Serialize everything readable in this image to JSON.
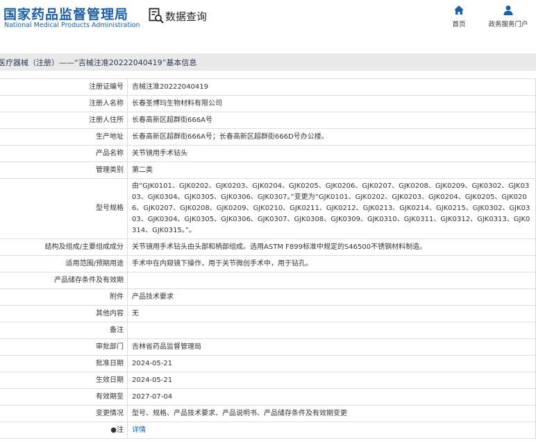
{
  "header": {
    "logo_cn": "国家药品监督管理局",
    "logo_en": "National Medical Products Administration",
    "query_label": "数据查询",
    "query_icon": "document-search-icon",
    "nav": [
      {
        "label": "首页",
        "icon": "home-icon"
      },
      {
        "label": "政务服务门户",
        "icon": "user-icon"
      }
    ]
  },
  "breadcrumb": "医疗器械（注册）——“吉械注准20222040419”基本信息",
  "fields": [
    {
      "label": "注册证编号",
      "value": "吉械注准20222040419"
    },
    {
      "label": "注册人名称",
      "value": "长春圣博玛生物材料有限公司"
    },
    {
      "label": "注册人住所",
      "value": "长春高新区超群街666A号"
    },
    {
      "label": "生产地址",
      "value": "长春高新区超群街666A号；长春高新区超群街666D号办公楼。"
    },
    {
      "label": "产品名称",
      "value": "关节镜用手术钻头"
    },
    {
      "label": "管理类别",
      "value": "第二类"
    },
    {
      "label": "型号规格",
      "value": "由“GJK0101、GJK0202、GJK0203、GJK0204、GJK0205、GJK0206、GJK0207、GJK0208、GJK0209、GJK0302、GJK0303、GJK0304、GJK0305、GJK0306、GJK0307。”变更为“GJK0101、GJK0202、GJK0203、GJK0204、GJK0205、GJK0206、GJK0207、GJK0208、GJK0209、GJK0210、GJK0211、GJK0212、GJK0213、GJK0214、GJK0215、GJK0302、GJK0303、GJK0304、GJK0305、GJK0306、GJK0307、GJK0308、GJK0309、GJK0310、GJK0311、GJK0312、GJK0313、GJK0314、GJK0315。”。"
    },
    {
      "label": "结构及组成/主要组成成分",
      "value": "关节镜用手术钻头由头部和柄部组成。选用ASTM F899标准中规定的S46500不锈钢材料制造。"
    },
    {
      "label": "适用范围/预期用途",
      "value": "手术中在内窥镜下操作，用于关节微创手术中，用于钻孔。"
    },
    {
      "label": "产品储存条件及有效期",
      "value": ""
    },
    {
      "label": "附件",
      "value": "产品技术要求"
    },
    {
      "label": "其他内容",
      "value": "无"
    },
    {
      "label": "备注",
      "value": ""
    },
    {
      "label": "审批部门",
      "value": "吉林省药品监督管理局"
    },
    {
      "label": "批准日期",
      "value": "2024-05-21"
    },
    {
      "label": "生效日期",
      "value": "2024-05-21"
    },
    {
      "label": "有效期至",
      "value": "2027-07-04"
    },
    {
      "label": "变更情况",
      "value": "型号、规格、产品技术要求、产品说明书、产品储存条件及有效期变更"
    },
    {
      "label": "●注",
      "value": "详情",
      "link": true
    }
  ],
  "colors": {
    "brand": "#1a5fa8",
    "crumb_bg": "#e9e9e9",
    "border": "#dcdcdc"
  }
}
